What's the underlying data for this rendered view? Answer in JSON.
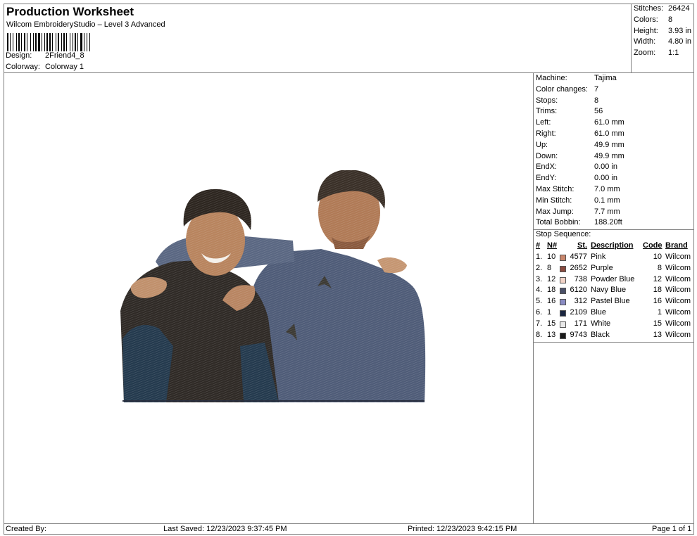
{
  "header": {
    "title": "Production Worksheet",
    "subtitle": "Wilcom EmbroideryStudio – Level 3 Advanced",
    "design_label": "Design:",
    "design_value": "2Friend4_8",
    "colorway_label": "Colorway:",
    "colorway_value": "Colorway 1"
  },
  "summary": {
    "stitches_label": "Stitches:",
    "stitches_value": "26424",
    "colors_label": "Colors:",
    "colors_value": "8",
    "height_label": "Height:",
    "height_value": "3.93 in",
    "width_label": "Width:",
    "width_value": "4.80 in",
    "zoom_label": "Zoom:",
    "zoom_value": "1:1"
  },
  "machine_info": [
    {
      "label": "Machine:",
      "value": "Tajima"
    },
    {
      "label": "Color changes:",
      "value": "7"
    },
    {
      "label": "Stops:",
      "value": "8"
    },
    {
      "label": "Trims:",
      "value": "56"
    },
    {
      "label": "Left:",
      "value": "61.0 mm"
    },
    {
      "label": "Right:",
      "value": "61.0 mm"
    },
    {
      "label": "Up:",
      "value": "49.9 mm"
    },
    {
      "label": "Down:",
      "value": "49.9 mm"
    },
    {
      "label": "EndX:",
      "value": "0.00 in"
    },
    {
      "label": "EndY:",
      "value": "0.00 in"
    },
    {
      "label": "Max Stitch:",
      "value": "7.0 mm"
    },
    {
      "label": "Min Stitch:",
      "value": "0.1 mm"
    },
    {
      "label": "Max Jump:",
      "value": "7.7 mm"
    },
    {
      "label": "Total Bobbin:",
      "value": "188.20ft"
    }
  ],
  "stop_sequence": {
    "title": "Stop Sequence:",
    "headers": {
      "num": "#",
      "n": "N#",
      "st": "St.",
      "description": "Description",
      "code": "Code",
      "brand": "Brand"
    },
    "rows": [
      {
        "num": "1.",
        "n": "10",
        "color": "#c8866c",
        "st": "4577",
        "description": "Pink",
        "code": "10",
        "brand": "Wilcom"
      },
      {
        "num": "2.",
        "n": "8",
        "color": "#8a4a3e",
        "st": "2652",
        "description": "Purple",
        "code": "8",
        "brand": "Wilcom"
      },
      {
        "num": "3.",
        "n": "12",
        "color": "#f2d4c8",
        "st": "738",
        "description": "Powder Blue",
        "code": "12",
        "brand": "Wilcom"
      },
      {
        "num": "4.",
        "n": "18",
        "color": "#4a5068",
        "st": "6120",
        "description": "Navy Blue",
        "code": "18",
        "brand": "Wilcom"
      },
      {
        "num": "5.",
        "n": "16",
        "color": "#8a8cc4",
        "st": "312",
        "description": "Pastel Blue",
        "code": "16",
        "brand": "Wilcom"
      },
      {
        "num": "6.",
        "n": "1",
        "color": "#1a2640",
        "st": "2109",
        "description": "Blue",
        "code": "1",
        "brand": "Wilcom"
      },
      {
        "num": "7.",
        "n": "15",
        "color": "#e8e8e8",
        "st": "171",
        "description": "White",
        "code": "15",
        "brand": "Wilcom"
      },
      {
        "num": "8.",
        "n": "13",
        "color": "#1a1a1a",
        "st": "9743",
        "description": "Black",
        "code": "13",
        "brand": "Wilcom"
      }
    ]
  },
  "footer": {
    "created_by": "Created By:",
    "last_saved": "Last Saved: 12/23/2023 9:37:45 PM",
    "printed": "Printed: 12/23/2023 9:42:15 PM",
    "page": "Page 1 of 1"
  }
}
